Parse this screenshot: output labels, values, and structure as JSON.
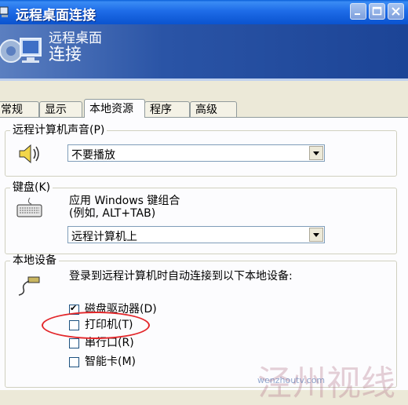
{
  "window": {
    "title": "远程桌面连接",
    "buttons": [
      "minimize",
      "maximize",
      "close"
    ]
  },
  "banner": {
    "line1": "远程桌面",
    "line2": "连接"
  },
  "tabs": [
    {
      "label": "常规",
      "active": false
    },
    {
      "label": "显示",
      "active": false
    },
    {
      "label": "本地资源",
      "active": true
    },
    {
      "label": "程序",
      "active": false
    },
    {
      "label": "高级",
      "active": false
    }
  ],
  "sound": {
    "group_label": "远程计算机声音(P)",
    "selected": "不要播放",
    "icon": "speaker-icon"
  },
  "keyboard": {
    "group_label": "键盘(K)",
    "description_line1": "应用 Windows 键组合",
    "description_line2": "(例如, ALT+TAB)",
    "selected": "远程计算机上",
    "icon": "keyboard-icon"
  },
  "local_devices": {
    "group_label": "本地设备",
    "description": "登录到远程计算机时自动连接到以下本地设备:",
    "icon": "device-cable-icon",
    "items": [
      {
        "label": "磁盘驱动器(D)",
        "checked": true
      },
      {
        "label": "打印机(T)",
        "checked": false
      },
      {
        "label": "串行口(R)",
        "checked": false
      },
      {
        "label": "智能卡(M)",
        "checked": false
      }
    ]
  },
  "annotation": {
    "color": "#e3262a"
  },
  "watermark": {
    "text": "泾州视线",
    "url": "wenzhoutv.com"
  }
}
